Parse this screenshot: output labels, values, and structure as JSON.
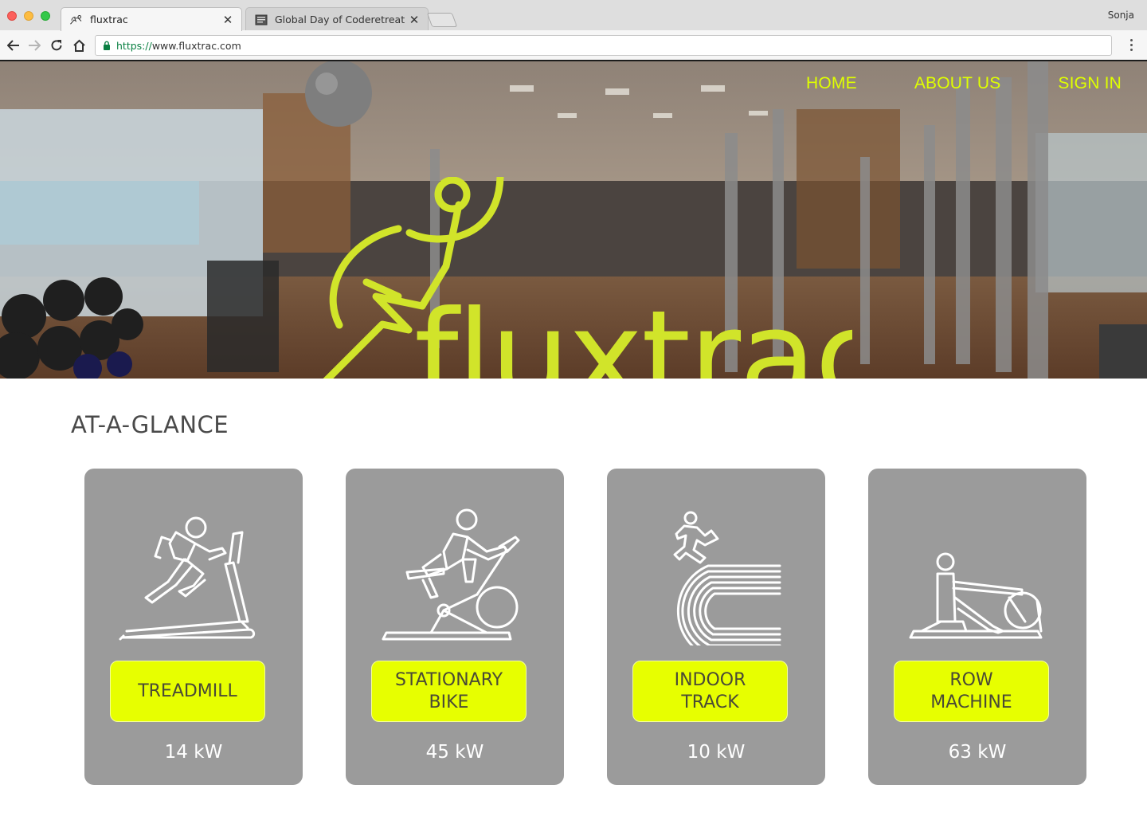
{
  "browser": {
    "tabs": [
      {
        "label": "fluxtrac",
        "icon": "runner-favicon-icon",
        "active": true
      },
      {
        "label": "Global Day of Coderetreat Val",
        "icon": "document-favicon-icon",
        "active": false
      }
    ],
    "profile_name": "Sonja",
    "url_scheme": "https://",
    "url_rest": "www.fluxtrac.com"
  },
  "nav": {
    "items": [
      "HOME",
      "ABOUT US",
      "SIGN IN"
    ]
  },
  "hero": {
    "logo_text": "fluxtrac",
    "accent_color": "#dfff00"
  },
  "section": {
    "title": "AT-A-GLANCE"
  },
  "cards": [
    {
      "label": "TREADMILL",
      "reading": "14 kW",
      "icon": "treadmill-icon"
    },
    {
      "label": "STATIONARY\nBIKE",
      "reading": "45 kW",
      "icon": "stationary-bike-icon"
    },
    {
      "label": "INDOOR\nTRACK",
      "reading": "10 kW",
      "icon": "indoor-track-icon"
    },
    {
      "label": "ROW\nMACHINE",
      "reading": "63 kW",
      "icon": "row-machine-icon"
    }
  ],
  "colors": {
    "card_bg": "#9b9b9b",
    "button_bg": "#e7ff00"
  }
}
